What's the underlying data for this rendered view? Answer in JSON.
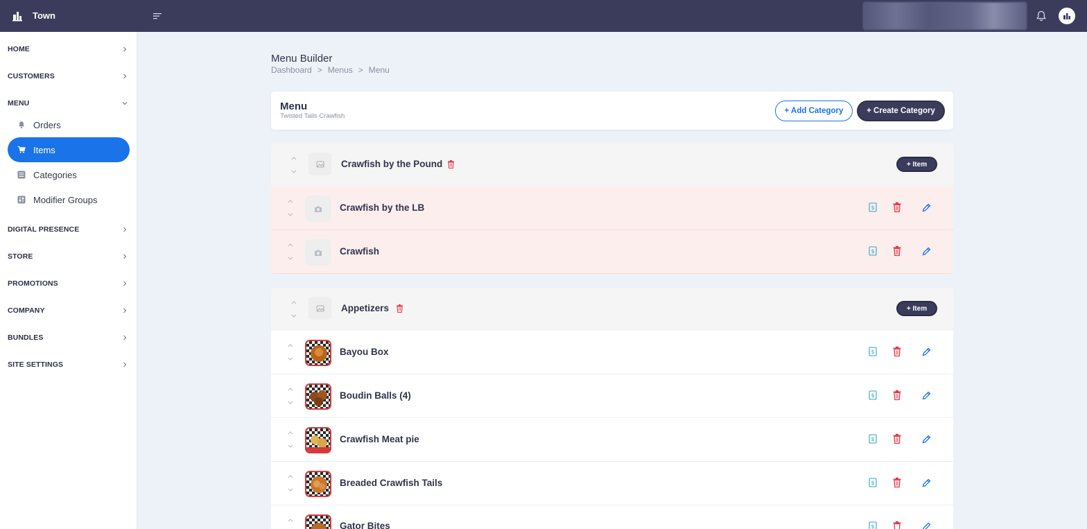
{
  "app": {
    "brand": "Town"
  },
  "sidebar": {
    "items": [
      {
        "label": "HOME",
        "expanded": false
      },
      {
        "label": "CUSTOMERS",
        "expanded": false
      },
      {
        "label": "MENU",
        "expanded": true
      },
      {
        "label": "DIGITAL PRESENCE",
        "expanded": false
      },
      {
        "label": "STORE",
        "expanded": false
      },
      {
        "label": "PROMOTIONS",
        "expanded": false
      },
      {
        "label": "COMPANY",
        "expanded": false
      },
      {
        "label": "BUNDLES",
        "expanded": false
      },
      {
        "label": "SITE SETTINGS",
        "expanded": false
      }
    ],
    "menu_children": [
      {
        "label": "Orders",
        "icon": "bell-icon",
        "active": false
      },
      {
        "label": "Items",
        "icon": "cart-icon",
        "active": true
      },
      {
        "label": "Categories",
        "icon": "list-icon",
        "active": false
      },
      {
        "label": "Modifier Groups",
        "icon": "sliders-icon",
        "active": false
      }
    ]
  },
  "page": {
    "title": "Menu Builder",
    "breadcrumb": [
      "Dashboard",
      "Menus",
      "Menu"
    ],
    "breadcrumb_separator": ">"
  },
  "menu": {
    "name": "Menu",
    "restaurant": "Twisted Tails Crawfish",
    "add_category_label": "+ Add Category",
    "create_category_label": "+ Create Category"
  },
  "categories": [
    {
      "name": "Crawfish by the Pound",
      "add_item_label": "+ Item",
      "items": [
        {
          "name": "Crawfish by the LB",
          "has_image": false,
          "status": "warning"
        },
        {
          "name": "Crawfish",
          "has_image": false,
          "status": "warning"
        }
      ]
    },
    {
      "name": "Appetizers",
      "add_item_label": "+ Item",
      "items": [
        {
          "name": "Bayou Box",
          "has_image": true,
          "status": "ok"
        },
        {
          "name": "Boudin Balls (4)",
          "has_image": true,
          "status": "ok"
        },
        {
          "name": "Crawfish Meat pie",
          "has_image": true,
          "status": "ok"
        },
        {
          "name": "Breaded Crawfish Tails",
          "has_image": true,
          "status": "ok"
        },
        {
          "name": "Gator Bites",
          "has_image": true,
          "status": "ok"
        }
      ]
    }
  ],
  "colors": {
    "topbar": "#3b3c5c",
    "accent": "#1a73e8",
    "danger": "#e0394a",
    "warning_row": "#fdeeee",
    "price_icon": "#2aa7c9"
  }
}
